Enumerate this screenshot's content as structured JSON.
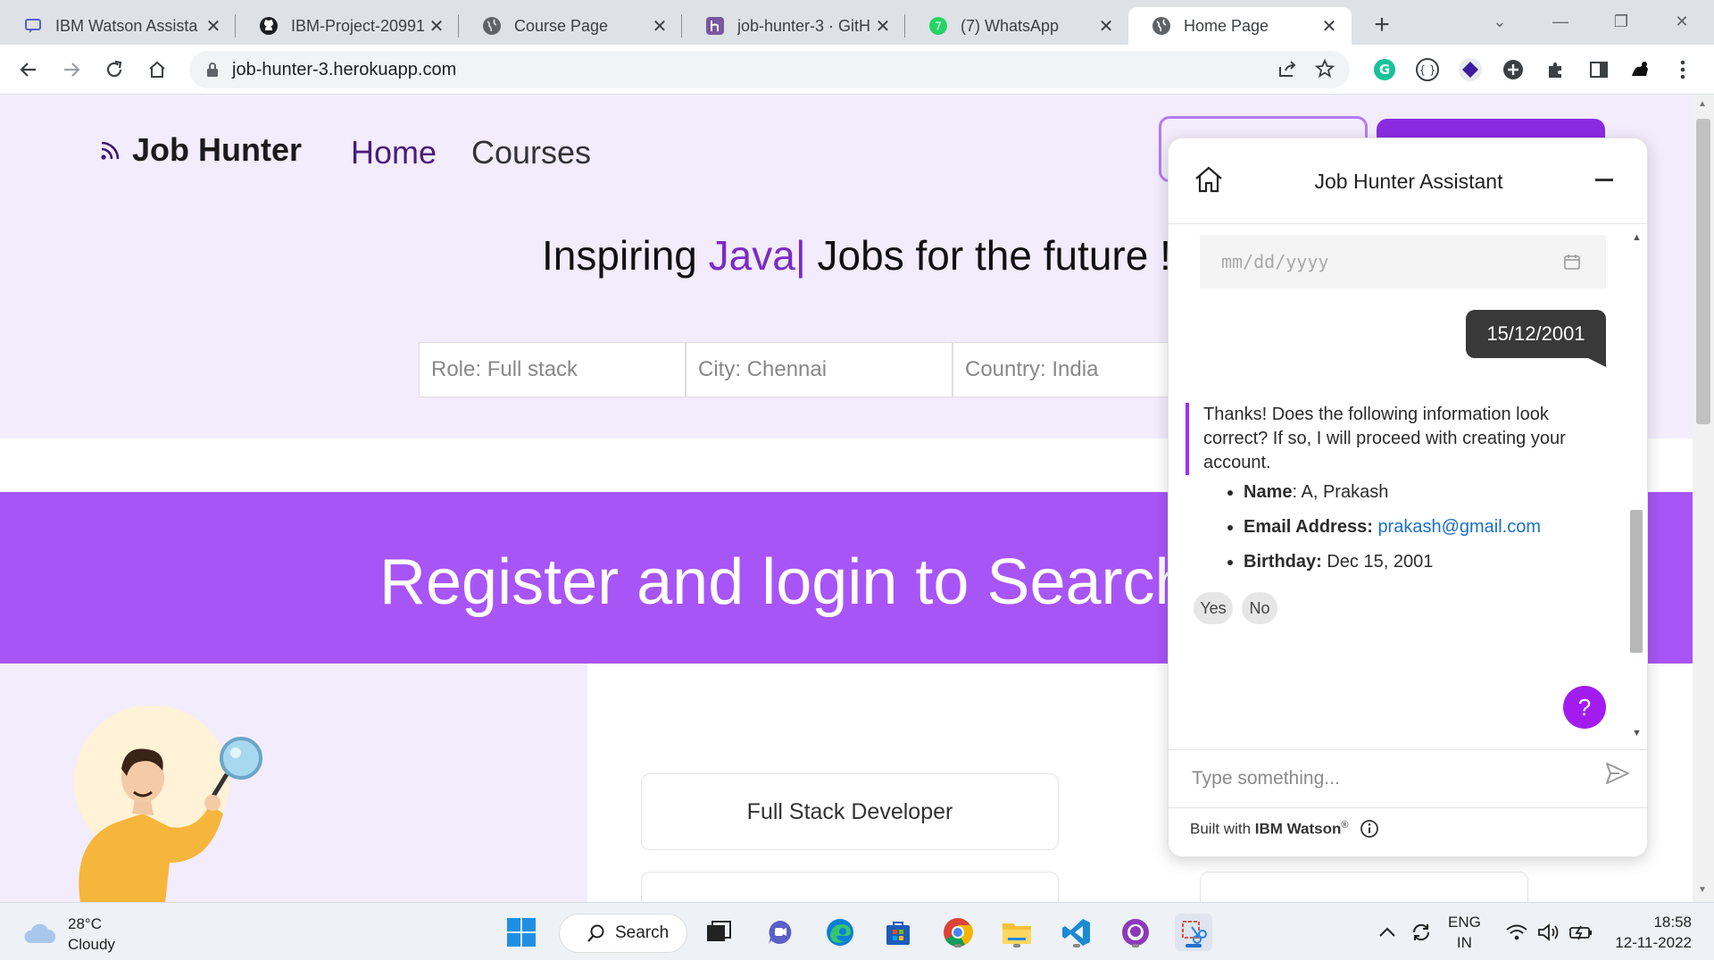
{
  "browser": {
    "tabs": [
      {
        "title": "IBM Watson Assista",
        "icon": "watson-icon"
      },
      {
        "title": "IBM-Project-20991",
        "icon": "github-icon"
      },
      {
        "title": "Course Page",
        "icon": "globe-icon"
      },
      {
        "title": "job-hunter-3 · GitH",
        "icon": "heroku-icon"
      },
      {
        "title": "(7) WhatsApp",
        "icon": "whatsapp-icon"
      },
      {
        "title": "Home Page",
        "icon": "globe-icon"
      }
    ],
    "active_tab": 5,
    "url": "job-hunter-3.herokuapp.com"
  },
  "page": {
    "logo_text": "Job Hunter",
    "nav": {
      "home": "Home",
      "courses": "Courses"
    },
    "headline": {
      "prefix": "Inspiring ",
      "accent": "Java|",
      "suffix": " Jobs for the future !"
    },
    "search": {
      "role": "Role: Full stack",
      "city": "City: Chennai",
      "country": "Country: India"
    },
    "banner_text": "Register and login to Search",
    "job_card": "Full Stack Developer"
  },
  "chat": {
    "title": "Job Hunter Assistant",
    "date_placeholder": "mm/dd/yyyy",
    "user_message": "15/12/2001",
    "bot_message": "Thanks! Does the following information look correct? If so, I will proceed with creating your account.",
    "details": {
      "name_label": "Name",
      "name_value": ": A, Prakash",
      "email_label": "Email Address:",
      "email_value": "prakash@gmail.com",
      "birthday_label": "Birthday:",
      "birthday_value": " Dec 15, 2001"
    },
    "options": {
      "yes": "Yes",
      "no": "No"
    },
    "help": "?",
    "input_placeholder": "Type something...",
    "footer_prefix": "Built with ",
    "footer_brand": "IBM Watson",
    "footer_mark": "®"
  },
  "taskbar": {
    "temperature": "28°C",
    "condition": "Cloudy",
    "search_label": "Search",
    "lang_1": "ENG",
    "lang_2": "IN",
    "time": "18:58",
    "date": "12-11-2022"
  },
  "colors": {
    "accent_purple": "#a855f7",
    "brand_purple": "#8a2be2",
    "hero_bg": "#f3ecfd",
    "bubble_bg": "#393939",
    "link_blue": "#1a6fc9"
  }
}
